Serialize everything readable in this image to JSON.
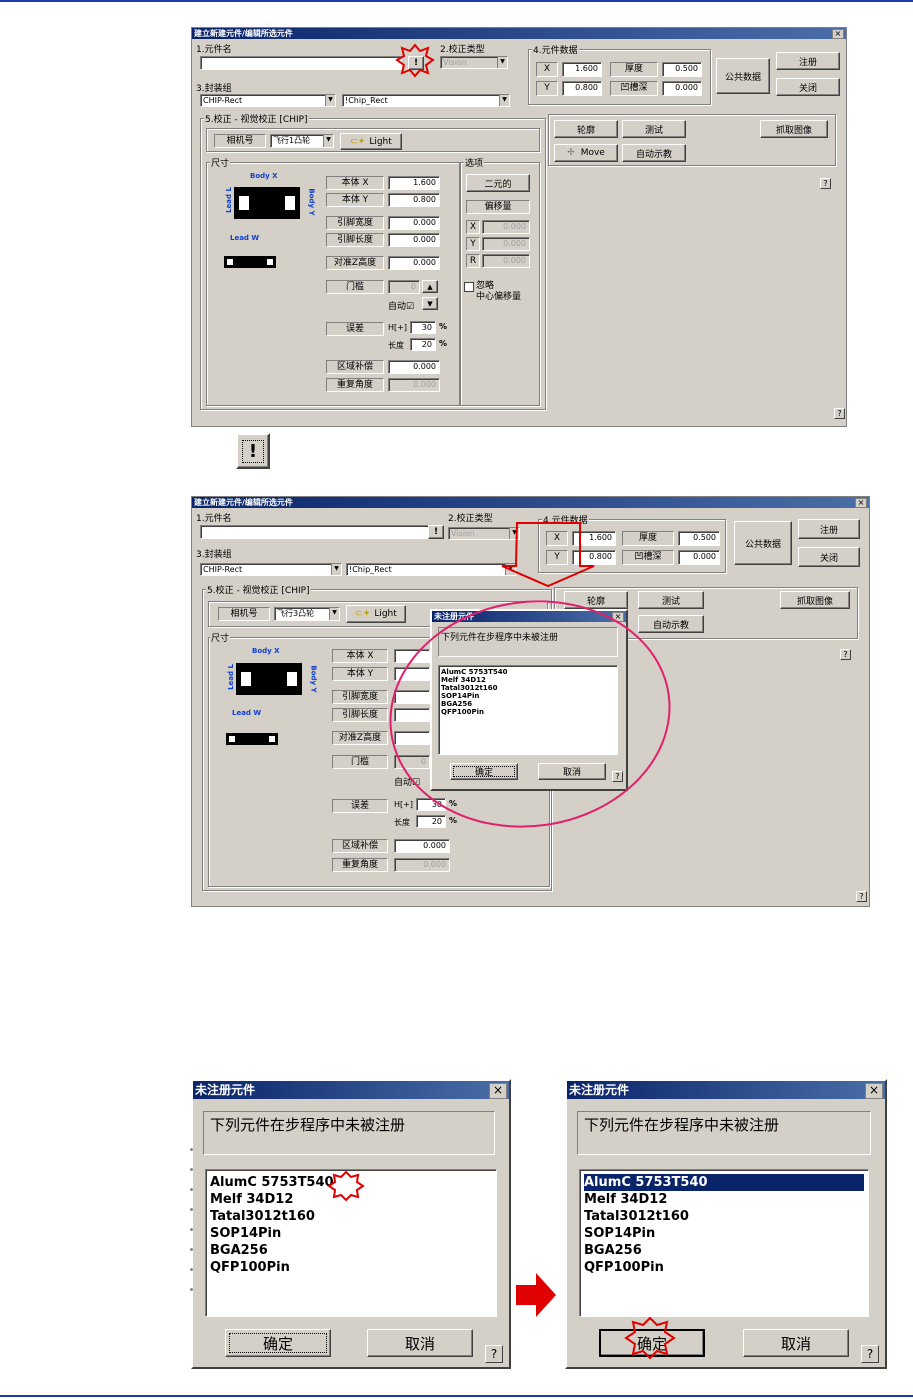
{
  "top_dialog": {
    "title": "建立新建元件/编辑所选元件",
    "close": "×",
    "part_name_label": "1.元件名",
    "part_name_value": "",
    "warn_button": "!",
    "align_type_label": "2.校正类型",
    "align_type_value": "Vision",
    "part_data_label": "4.元件数据",
    "x_label": "X",
    "x_value": "1.600",
    "y_label": "Y",
    "y_value": "0.800",
    "thickness_label": "厚度",
    "thickness_value": "0.500",
    "groove_label": "凹槽深",
    "groove_value": "0.000",
    "common_data_button": "公共数据",
    "register_button": "注册",
    "close_button": "关闭",
    "package_label": "3.封装组",
    "package_value": "CHIP-Rect",
    "package_name_value": "!Chip_Rect",
    "vision_group_label": "5.校正 - 视觉校正 [CHIP]",
    "camera_label": "相机号",
    "camera_value": "飞行1凸轮",
    "light_button": "Light",
    "outline_button": "轮廓",
    "test_button": "测试",
    "capture_button": "抓取图像",
    "move_button": "Move",
    "auto_teach_button": "自动示教",
    "help": "?",
    "dimension_label": "尺寸",
    "diagram_body_x": "Body X",
    "diagram_body_y": "Body Y",
    "diagram_lead_l": "Lead L",
    "diagram_lead_w": "Lead W",
    "body_x_label": "本体 X",
    "body_x_value": "1.600",
    "body_y_label": "本体 Y",
    "body_y_value": "0.800",
    "lead_width_label": "引脚宽度",
    "lead_width_value": "0.000",
    "lead_length_label": "引脚长度",
    "lead_length_value": "0.000",
    "align_z_label": "对准Z高度",
    "align_z_value": "0.000",
    "threshold_label": "门槛",
    "threshold_value": "0",
    "auto_label": "自动☑",
    "error_label": "误差",
    "error_h_label": "H[+]",
    "error_h_value": "30",
    "error_l_label": "长度",
    "error_l_value": "20",
    "percent": "%",
    "area_comp_label": "区域补偿",
    "area_comp_value": "0.000",
    "repeat_angle_label": "重复角度",
    "repeat_angle_value": "0.000",
    "options_label": "选项",
    "binary_button": "二元的",
    "offset_label": "偏移量",
    "off_x_label": "X",
    "off_x_value": "0.000",
    "off_y_label": "Y",
    "off_y_value": "0.000",
    "off_r_label": "R",
    "off_r_value": "0.000",
    "ignore_label_1": "忽略",
    "ignore_label_2": "中心偏移量"
  },
  "middle_dialog": {
    "camera_value": "飞行3凸轮",
    "auto_label": "自动☑",
    "popup_title": "未注册元件",
    "close": "×"
  },
  "unregistered_dialog": {
    "title": "未注册元件",
    "close": "×",
    "message": "下列元件在步程序中未被注册",
    "items": [
      "AlumC 5753T540",
      "Melf 34D12",
      "Tatal3012t160",
      "SOP14Pin",
      "BGA256",
      "QFP100Pin"
    ],
    "ok_button": "确定",
    "cancel_button": "取消",
    "help": "?"
  },
  "colors": {
    "title_bar": "#0a246a",
    "dialog_face": "#d4d0c8",
    "callout_red": "#e00000",
    "highlight_circle": "#e0206a",
    "selection": "#0a246a",
    "rule_blue": "#1f3aa8"
  }
}
